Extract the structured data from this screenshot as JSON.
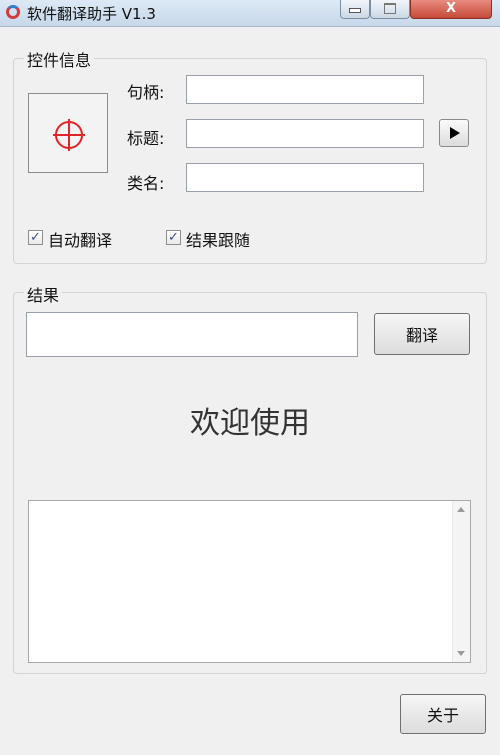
{
  "window": {
    "title": "软件翻译助手 V1.3",
    "close_glyph": "X"
  },
  "control_info": {
    "group_label": "控件信息",
    "target_icon": "crosshair-target-icon",
    "handle_label": "句柄:",
    "handle_value": "",
    "title_label": "标题:",
    "title_value": "",
    "class_label": "类名:",
    "class_value": "",
    "play_icon": "play-triangle-icon"
  },
  "options": {
    "auto_translate_label": "自动翻译",
    "auto_translate_checked": true,
    "follow_result_label": "结果跟随",
    "follow_result_checked": true,
    "check_glyph": "✓"
  },
  "result": {
    "group_label": "结果",
    "input_value": "",
    "translate_button": "翻译",
    "welcome_text": "欢迎使用",
    "output_text": ""
  },
  "footer": {
    "about_button": "关于"
  },
  "colors": {
    "target_red": "#e0262b",
    "close_button": "#c6493a"
  }
}
